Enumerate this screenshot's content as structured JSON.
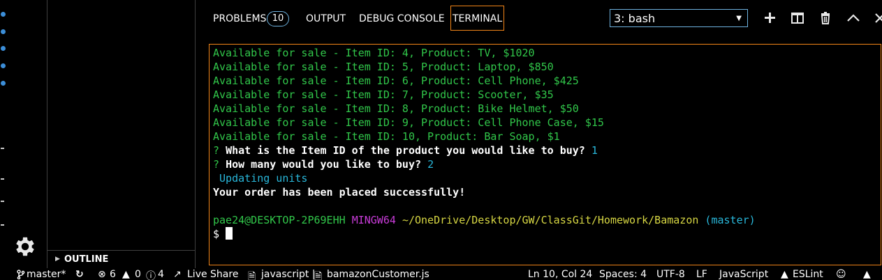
{
  "sidebar": {
    "outline_label": "OUTLINE"
  },
  "panel": {
    "tabs": {
      "problems": "PROBLEMS",
      "problems_count": "10",
      "output": "OUTPUT",
      "debug_console": "DEBUG CONSOLE",
      "terminal": "TERMINAL"
    },
    "terminal_select": "3: bash"
  },
  "terminal": {
    "items": [
      "Available for sale - Item ID: 4, Product: TV, $1020",
      "Available for sale - Item ID: 5, Product: Laptop, $850",
      "Available for sale - Item ID: 6, Product: Cell Phone, $425",
      "Available for sale - Item ID: 7, Product: Scooter, $35",
      "Available for sale - Item ID: 8, Product: Bike Helmet, $50",
      "Available for sale - Item ID: 9, Product: Cell Phone Case, $15",
      "Available for sale - Item ID: 10, Product: Bar Soap, $1"
    ],
    "q1_mark": "?",
    "q1_text": "What is the Item ID of the product you would like to buy?",
    "q1_answer": "1",
    "q2_mark": "?",
    "q2_text": "How many would you like to buy?",
    "q2_answer": "2",
    "updating": " Updating units",
    "success": "Your order has been placed successfully!",
    "prompt_user": "pae24@DESKTOP-2P69EHH",
    "prompt_env": "MINGW64",
    "prompt_path": "~/OneDrive/Desktop/GW/ClassGit/Homework/Bamazon",
    "prompt_branch": "(master)",
    "dollar": "$"
  },
  "status": {
    "branch": "master*",
    "errors": "6",
    "warnings": "0",
    "info": "4",
    "live_share": "Live Share",
    "language_file": "javascript |",
    "file": "bamazonCustomer.js",
    "position": "Ln 10, Col 24",
    "spaces": "Spaces: 4",
    "encoding": "UTF-8",
    "eol": "LF",
    "language": "JavaScript",
    "eslint": "ESLint"
  }
}
